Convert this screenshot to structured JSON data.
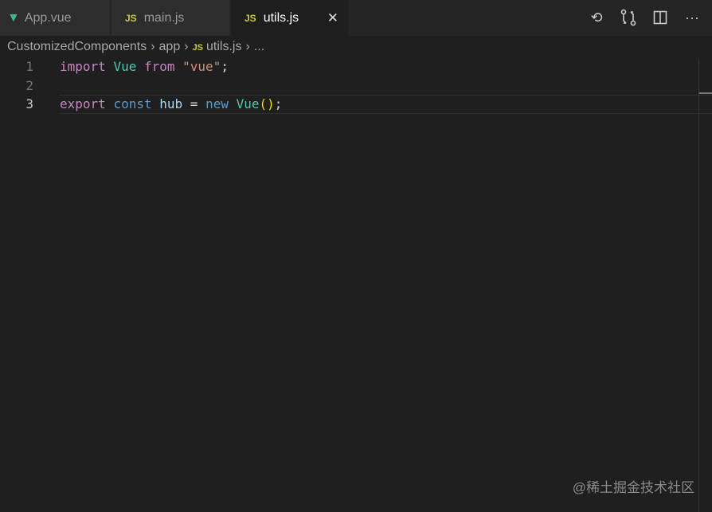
{
  "tabs": [
    {
      "label": "App.vue",
      "icon": "vue-icon"
    },
    {
      "label": "main.js",
      "icon": "JS"
    },
    {
      "label": "utils.js",
      "icon": "JS",
      "active": true
    }
  ],
  "tab_icon_js": "JS",
  "breadcrumb": [
    "CustomizedComponents",
    "app",
    "utils.js",
    "..."
  ],
  "code": {
    "lines": [
      "1",
      "2",
      "3"
    ],
    "l1": [
      "import",
      " ",
      "Vue",
      " ",
      "from",
      " ",
      "\"vue\"",
      ";"
    ],
    "l3": [
      "export",
      " ",
      "const",
      " ",
      "hub",
      " = ",
      "new",
      " ",
      "Vue",
      "(",
      ")",
      ";"
    ]
  },
  "watermark": "@稀土掘金技术社区"
}
